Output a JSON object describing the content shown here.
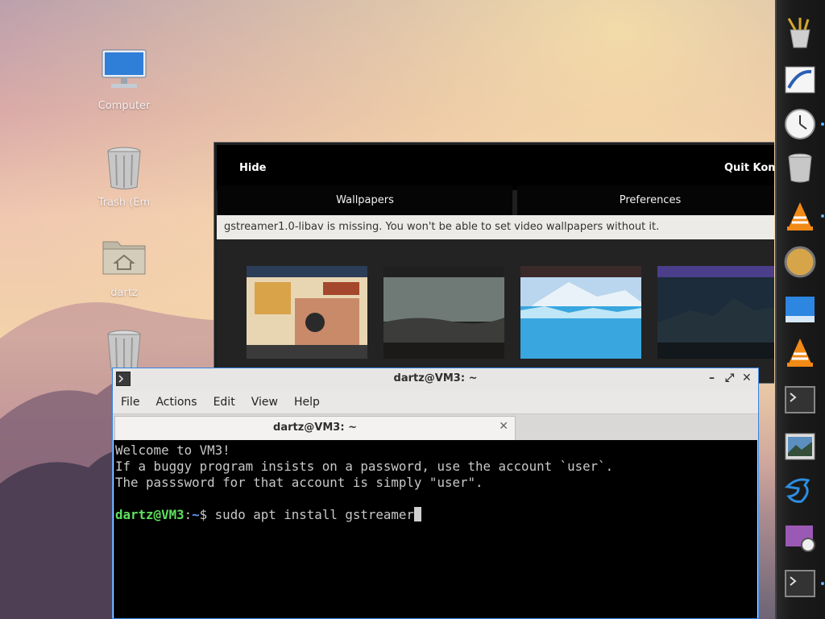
{
  "desktop": {
    "icons": [
      {
        "label": "Computer",
        "icon": "computer-icon"
      },
      {
        "label": "Trash (Em",
        "icon": "trash-icon"
      },
      {
        "label": "dartz",
        "icon": "home-folder-icon"
      },
      {
        "label": "",
        "icon": "trash-icon"
      }
    ]
  },
  "komorebi": {
    "hide_label": "Hide",
    "quit_label": "Quit Kome",
    "tabs": [
      "Wallpapers",
      "Preferences"
    ],
    "warning": "gstreamer1.0-libav is missing. You won't be able to set video wallpapers without it.",
    "wallpapers": [
      "mural-wallpaper",
      "foggy-hills-wallpaper",
      "glacier-wallpaper",
      "dark-mountain-wallpaper"
    ]
  },
  "terminal": {
    "title": "dartz@VM3: ~",
    "menu": [
      "File",
      "Actions",
      "Edit",
      "View",
      "Help"
    ],
    "tab_title": "dartz@VM3: ~",
    "lines": [
      "Welcome to VM3!",
      "If a buggy program insists on a password, use the account `user`.",
      "The passsword for that account is simply \"user\"."
    ],
    "prompt_user": "dartz@VM3",
    "prompt_sep": ":",
    "prompt_path": "~",
    "prompt_symbol": "$ ",
    "command": "sudo apt install gstreamer"
  },
  "dock": {
    "items": [
      "brush-cup-icon",
      "text-editor-icon",
      "clock-icon",
      "trash-icon",
      "vlc-icon",
      "sphere-icon",
      "window-icon",
      "vlc-icon",
      "terminal-icon",
      "image-viewer-icon",
      "bird-icon",
      "screenshot-icon",
      "terminal-icon"
    ]
  },
  "colors": {
    "accent": "#3584e4",
    "prompt_user": "#5ee05e",
    "prompt_path": "#5c9cf7",
    "warning_bg": "#ecebe7"
  }
}
